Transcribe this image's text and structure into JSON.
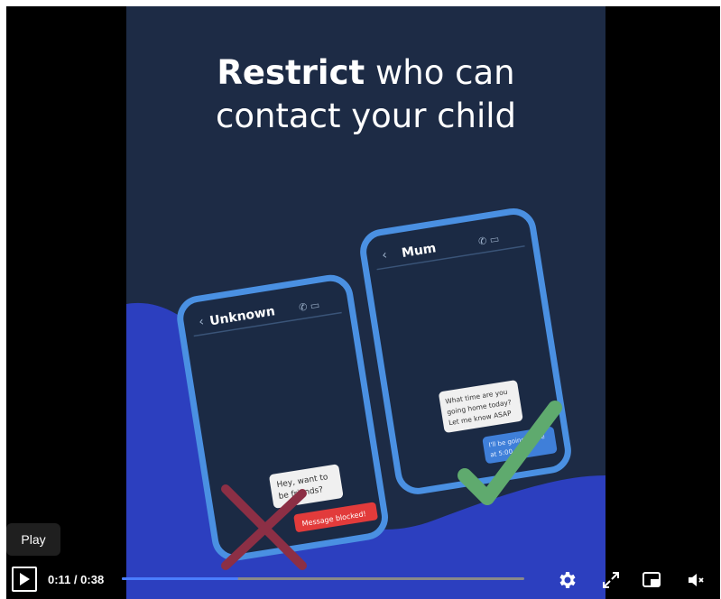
{
  "video": {
    "headline_bold": "Restrict",
    "headline_rest_line1": " who can",
    "headline_line2": "contact your child",
    "phone_left": {
      "contact_name": "Unknown",
      "incoming_message": "Hey, want to be friends?",
      "blocked_label": "Message blocked!"
    },
    "phone_right": {
      "contact_name": "Mum",
      "incoming_message_line1": "What time are you",
      "incoming_message_line2": "going home today?",
      "incoming_message_line3": "Let me know ASAP",
      "outgoing_message_line1": "I'll be going home",
      "outgoing_message_line2": "at 5:00 pm"
    },
    "colors": {
      "background": "#1d2b45",
      "wave": "#2c3fbf",
      "phone_frame": "#4a90e2",
      "check": "#5faa6e",
      "cross": "#8c2f45",
      "blocked": "#e23b3b"
    }
  },
  "tooltip": {
    "label": "Play"
  },
  "controls": {
    "current_time": "0:11",
    "duration": "0:38",
    "progress_fraction": 0.29,
    "icons": [
      "play-icon",
      "gear-icon",
      "fullscreen-icon",
      "picture-in-picture-icon",
      "volume-muted-icon"
    ]
  }
}
